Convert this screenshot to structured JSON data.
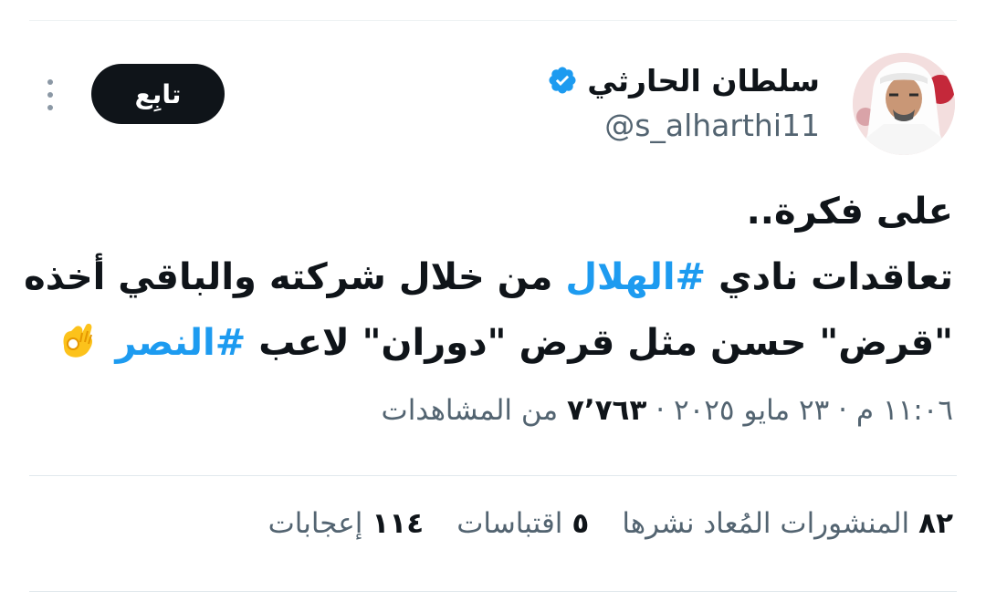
{
  "user": {
    "display_name": "سلطان الحارثي",
    "handle": "@s_alharthi11",
    "verified": true,
    "verified_icon": "verified-badge-icon",
    "avatar_icon": "profile-avatar"
  },
  "follow_button": {
    "label": "تابِع"
  },
  "more_menu": {
    "icon": "vertical-ellipsis-icon"
  },
  "tweet": {
    "line1": "على فكرة..",
    "line2_start": "تعاقدات نادي",
    "line2_hashtag": "#الهلال",
    "line2_end": "من خلال شركته والباقي أخذه",
    "line3_start": "\"قرض\" حسن مثل قرض \"دوران\" لاعب",
    "line3_hashtag": "#النصر",
    "emoji": "ok-hand-emoji"
  },
  "meta": {
    "time": "١١:٠٦ م",
    "separator1": "·",
    "date": "٢٣ مايو ٢٠٢٥",
    "separator2": "·",
    "views_count": "٧٬٧٦٣",
    "views_label": "من المشاهدات"
  },
  "stats": {
    "reposts_count": "٨٢",
    "reposts_label": "المنشورات المُعاد نشرها",
    "quotes_count": "٥",
    "quotes_label": "اقتباسات",
    "likes_count": "١١٤",
    "likes_label": "إعجابات"
  },
  "colors": {
    "text": "#0f1419",
    "secondary": "#536471",
    "accent": "#1d9bf0",
    "button_bg": "#0f1419",
    "button_text": "#ffffff",
    "divider": "#e1e8ed"
  }
}
